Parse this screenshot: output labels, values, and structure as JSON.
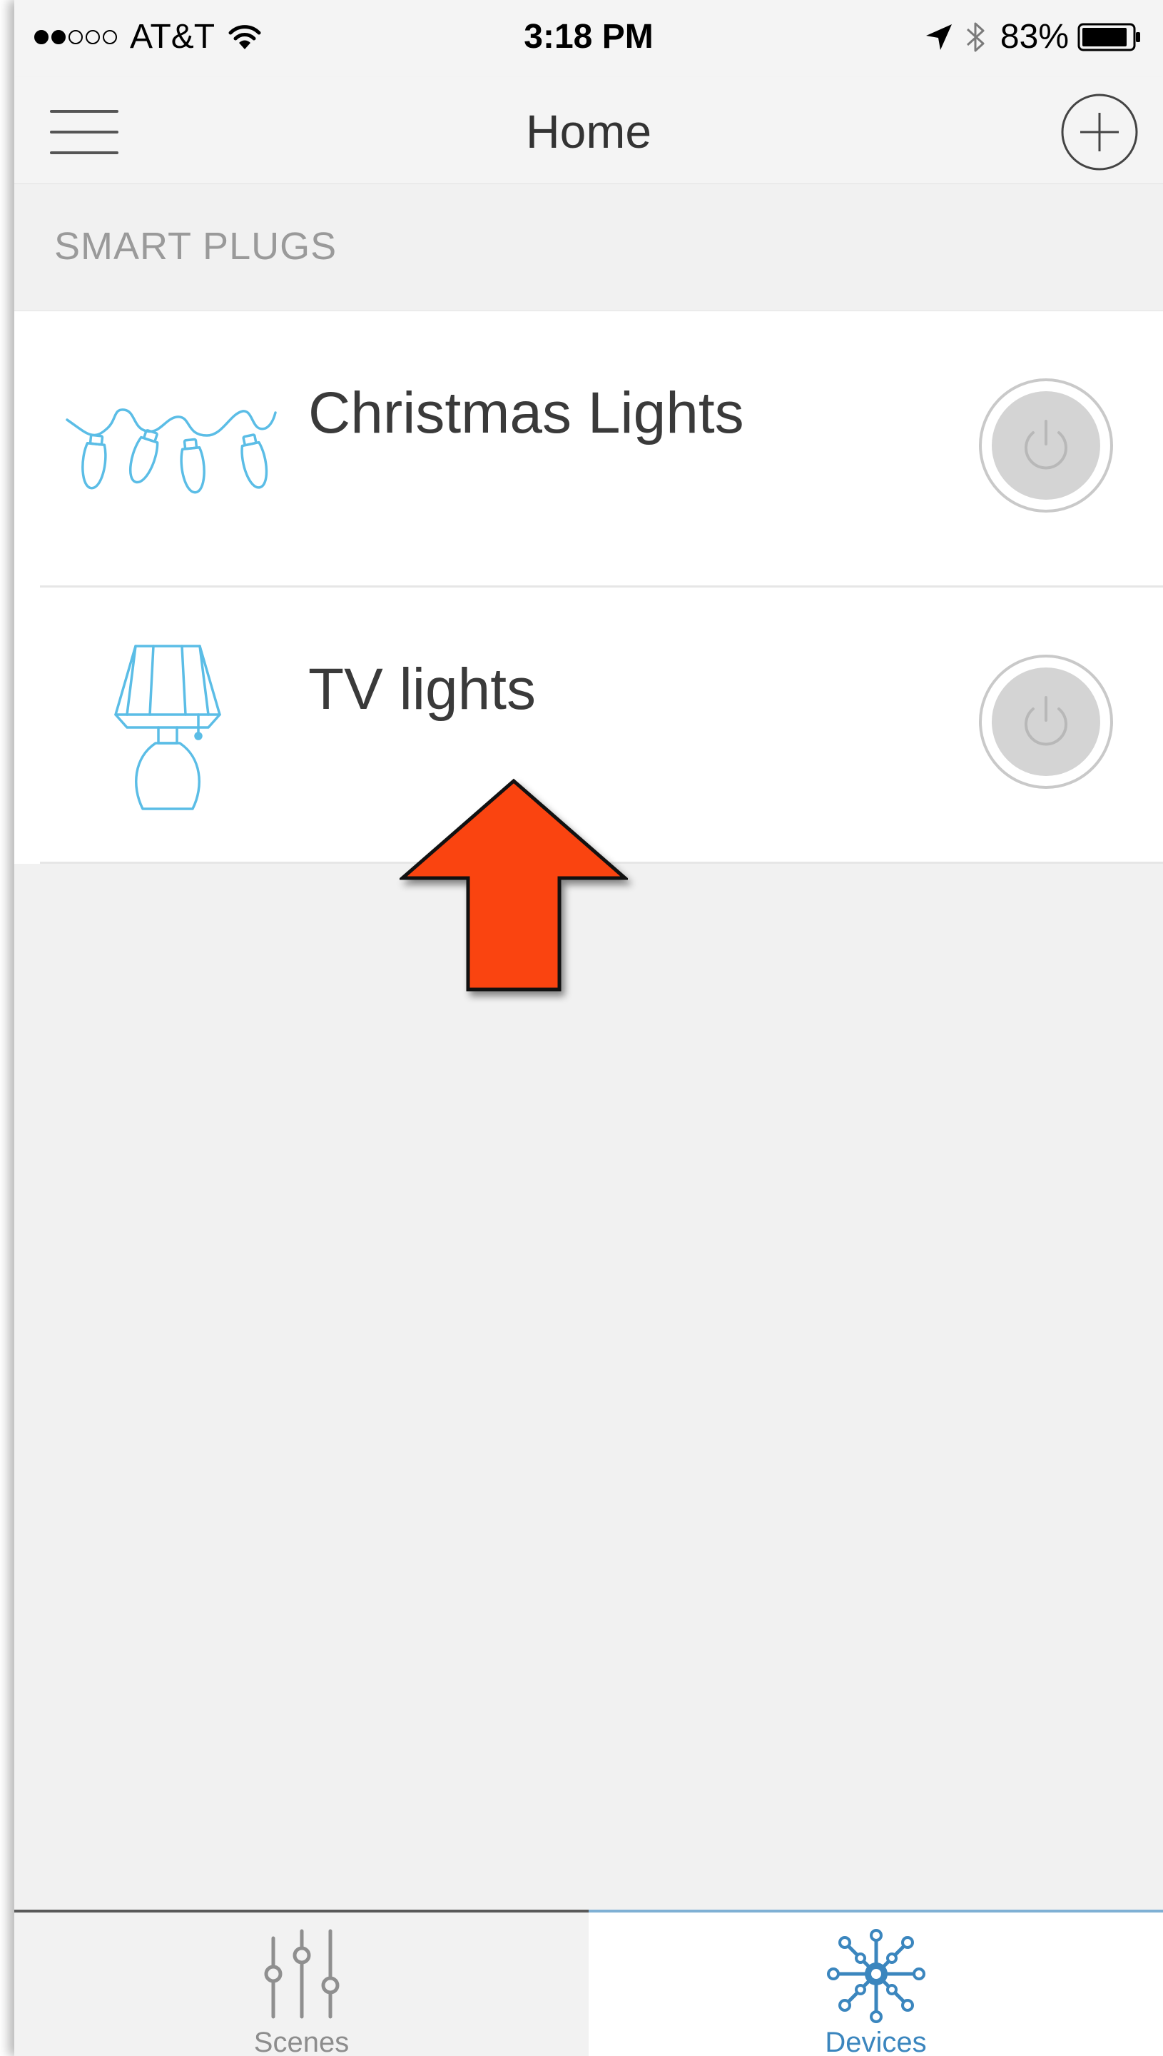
{
  "status_bar": {
    "carrier": "AT&T",
    "signal_bars_filled": 2,
    "signal_bars_total": 5,
    "time": "3:18 PM",
    "battery_percent": "83%",
    "icons": [
      "wifi-icon",
      "location-arrow-icon",
      "bluetooth-icon",
      "battery-icon"
    ]
  },
  "nav": {
    "title": "Home",
    "menu_icon": "hamburger-menu-icon",
    "add_icon": "plus-circle-icon"
  },
  "section": {
    "title": "SMART PLUGS"
  },
  "devices": [
    {
      "name": "Christmas Lights",
      "icon": "string-lights-icon",
      "power_state": "off"
    },
    {
      "name": "TV lights",
      "icon": "table-lamp-icon",
      "power_state": "off"
    }
  ],
  "annotation": {
    "type": "arrow",
    "direction": "up",
    "color": "#fa4410"
  },
  "tab_bar": {
    "tabs": [
      {
        "label": "Scenes",
        "icon": "sliders-icon",
        "selected": false
      },
      {
        "label": "Devices",
        "icon": "network-hub-icon",
        "selected": true
      }
    ]
  },
  "colors": {
    "accent": "#3b86be",
    "icon_blue": "#5bbde6",
    "background": "#f1f1f1",
    "power_button": "#d4d4d4"
  }
}
